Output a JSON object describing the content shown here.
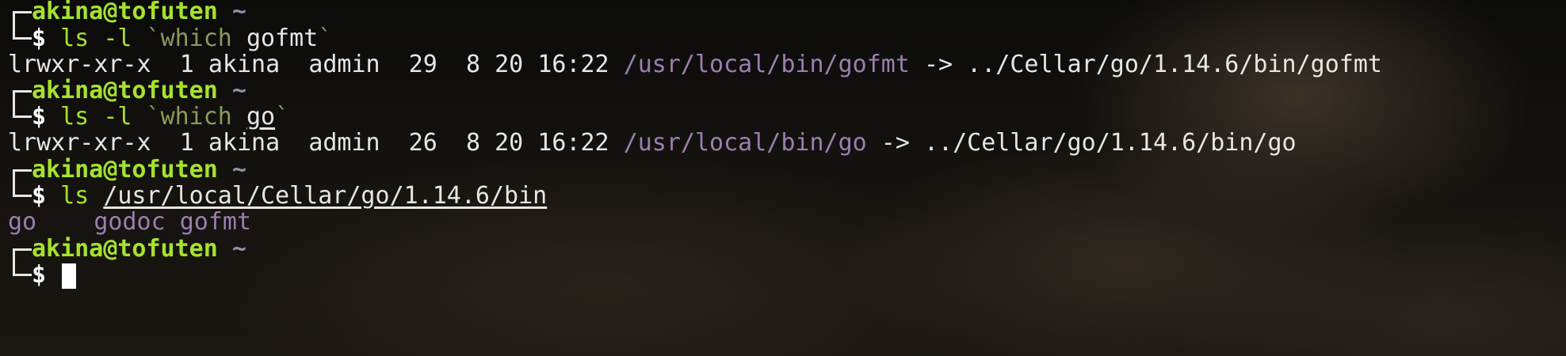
{
  "prompt": {
    "user_host": "akina@tofuten",
    "dir": "~",
    "symbol": "$"
  },
  "blocks": [
    {
      "command": "ls",
      "arg1": "-l",
      "backtick_open": "`",
      "sub_cmd": "which",
      "sub_arg": "gofmt",
      "backtick_close": "`",
      "output": {
        "perms": "lrwxr-xr-x",
        "links": "1",
        "owner": "akina",
        "group": "admin",
        "size": "29",
        "month": "8",
        "day": "20",
        "time": "16:22",
        "path": "/usr/local/bin/gofmt",
        "arrow": "->",
        "target": "../Cellar/go/1.14.6/bin/gofmt"
      }
    },
    {
      "command": "ls",
      "arg1": "-l",
      "backtick_open": "`",
      "sub_cmd": "which",
      "sub_arg": "go",
      "backtick_close": "`",
      "output": {
        "perms": "lrwxr-xr-x",
        "links": "1",
        "owner": "akina",
        "group": "admin",
        "size": "26",
        "month": "8",
        "day": "20",
        "time": "16:22",
        "path": "/usr/local/bin/go",
        "arrow": "->",
        "target": "../Cellar/go/1.14.6/bin/go"
      }
    },
    {
      "command": "ls",
      "arg": "/usr/local/Cellar/go/1.14.6/bin",
      "items": [
        "go",
        "godoc",
        "gofmt"
      ]
    }
  ]
}
